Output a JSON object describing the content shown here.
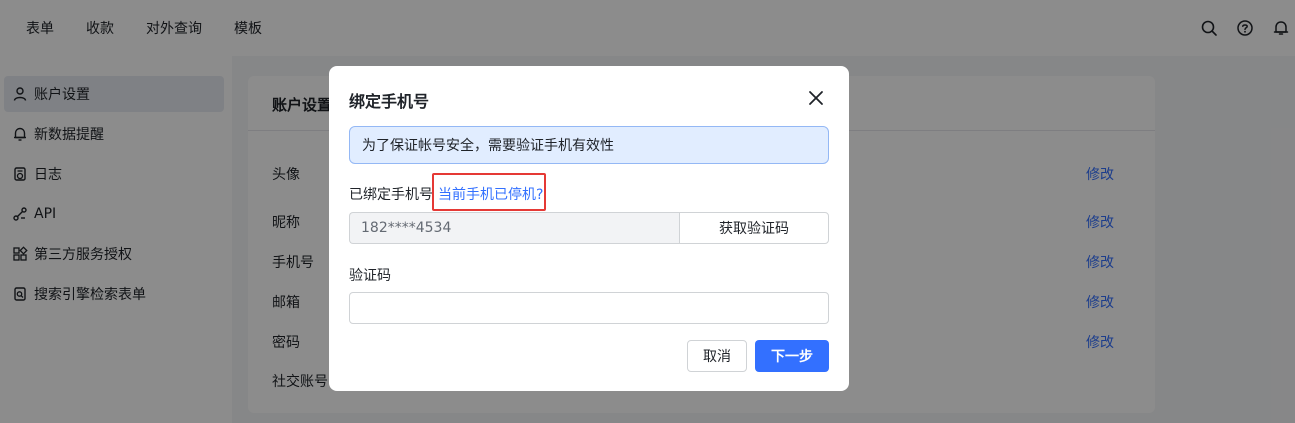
{
  "topnav": {
    "items": [
      "表单",
      "收款",
      "对外查询",
      "模板"
    ],
    "icons": [
      "search-icon",
      "help-icon",
      "bell-icon"
    ]
  },
  "sidebar": {
    "items": [
      {
        "label": "账户设置",
        "icon": "user-icon",
        "active": true
      },
      {
        "label": "新数据提醒",
        "icon": "bell-icon",
        "active": false
      },
      {
        "label": "日志",
        "icon": "log-icon",
        "active": false
      },
      {
        "label": "API",
        "icon": "api-icon",
        "active": false
      },
      {
        "label": "第三方服务授权",
        "icon": "apps-icon",
        "active": false
      },
      {
        "label": "搜索引擎检索表单",
        "icon": "search-form-icon",
        "active": false
      }
    ]
  },
  "account": {
    "title": "账户设置",
    "fields": [
      "头像",
      "昵称",
      "手机号",
      "邮箱",
      "密码",
      "社交账号"
    ],
    "edit_label": "修改"
  },
  "modal": {
    "title": "绑定手机号",
    "notice": "为了保证帐号安全，需要验证手机有效性",
    "phone_label": "已绑定手机号",
    "phone_link": "当前手机已停机?",
    "phone_value": "182****4534",
    "get_code_label": "获取验证码",
    "code_label": "验证码",
    "code_value": "",
    "cancel_label": "取消",
    "next_label": "下一步"
  },
  "colors": {
    "primary": "#3370ff",
    "highlight_border": "#e53935",
    "notice_bg": "#e1edff"
  }
}
